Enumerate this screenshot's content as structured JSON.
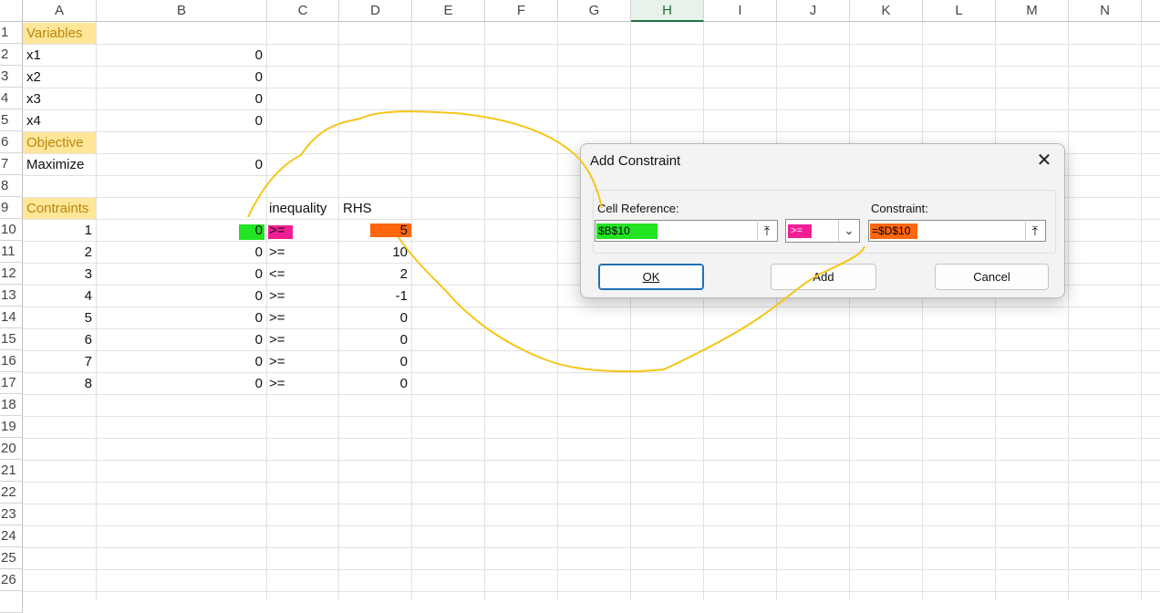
{
  "columns": [
    "A",
    "B",
    "C",
    "D",
    "E",
    "F",
    "G",
    "H",
    "I",
    "J",
    "K",
    "L",
    "M",
    "N"
  ],
  "selected_column": "H",
  "rows": [
    "1",
    "2",
    "3",
    "4",
    "5",
    "6",
    "7",
    "8",
    "9",
    "10",
    "11",
    "12",
    "13",
    "14",
    "15",
    "16",
    "17",
    "18",
    "19",
    "20",
    "21",
    "22",
    "23",
    "24",
    "25",
    "26"
  ],
  "sheet": {
    "variables_label": "Variables",
    "variables": [
      {
        "name": "x1",
        "value": "0"
      },
      {
        "name": "x2",
        "value": "0"
      },
      {
        "name": "x3",
        "value": "0"
      },
      {
        "name": "x4",
        "value": "0"
      }
    ],
    "objective_label": "Objective",
    "objective_name": "Maximize",
    "objective_value": "0",
    "constraints_label": "Contraints",
    "inequality_header": "inequality",
    "rhs_header": "RHS",
    "constraints": [
      {
        "id": "1",
        "lhs": "0",
        "op": ">=",
        "rhs": "5"
      },
      {
        "id": "2",
        "lhs": "0",
        "op": ">=",
        "rhs": "10"
      },
      {
        "id": "3",
        "lhs": "0",
        "op": "<=",
        "rhs": "2"
      },
      {
        "id": "4",
        "lhs": "0",
        "op": ">=",
        "rhs": "-1"
      },
      {
        "id": "5",
        "lhs": "0",
        "op": ">=",
        "rhs": "0"
      },
      {
        "id": "6",
        "lhs": "0",
        "op": ">=",
        "rhs": "0"
      },
      {
        "id": "7",
        "lhs": "0",
        "op": ">=",
        "rhs": "0"
      },
      {
        "id": "8",
        "lhs": "0",
        "op": ">=",
        "rhs": "0"
      }
    ]
  },
  "dialog": {
    "title": "Add Constraint",
    "cell_reference_label": "Cell Reference:",
    "cell_reference_value": "$B$10",
    "operator_value": ">=",
    "constraint_label": "Constraint:",
    "constraint_value": "=$D$10",
    "ok_label": "OK",
    "add_label": "Add",
    "cancel_label": "Cancel"
  },
  "colors": {
    "highlight_yellow": "#ffe699",
    "mark_green": "#22e422",
    "mark_pink": "#f21e96",
    "mark_orange": "#ff6610",
    "annotation_line": "#f5c518"
  }
}
